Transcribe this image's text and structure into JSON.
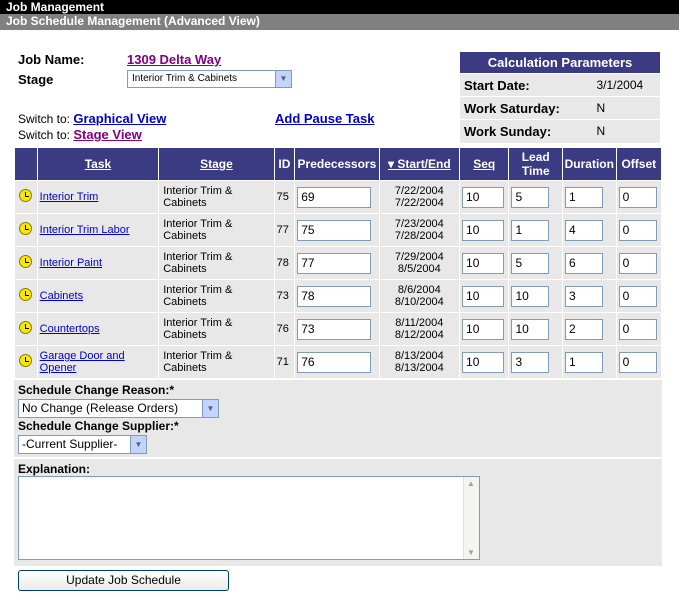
{
  "header": {
    "title": "Job Management",
    "subtitle": "Job Schedule Management (Advanced View)"
  },
  "job": {
    "name_label": "Job Name:",
    "name": "1309 Delta Way",
    "stage_label": "Stage",
    "stage_value": "Interior Trim & Cabinets"
  },
  "switch": {
    "prefix1": "Switch to:",
    "graphical": "Graphical View",
    "prefix2": "Switch to:",
    "stage": "Stage View",
    "add_pause": "Add Pause Task"
  },
  "calc": {
    "title": "Calculation Parameters",
    "rows": [
      {
        "label": "Start Date:",
        "value": "3/1/2004"
      },
      {
        "label": "Work Saturday:",
        "value": "N"
      },
      {
        "label": "Work Sunday:",
        "value": "N"
      }
    ]
  },
  "table": {
    "headers": {
      "task": "Task",
      "stage": "Stage",
      "id": "ID",
      "predecessors": "Predecessors",
      "startend": "Start/End",
      "seq": "Seq",
      "lead1": "Lead",
      "lead2": "Time",
      "duration": "Duration",
      "offset": "Offset"
    },
    "rows": [
      {
        "task": "Interior Trim",
        "stage1": "Interior Trim &",
        "stage2": "Cabinets",
        "id": "75",
        "pred": "69",
        "start": "7/22/2004",
        "end": "7/22/2004",
        "seq": "10",
        "lead": "5",
        "duration": "1",
        "offset": "0"
      },
      {
        "task": "Interior Trim Labor",
        "stage1": "Interior Trim &",
        "stage2": "Cabinets",
        "id": "77",
        "pred": "75",
        "start": "7/23/2004",
        "end": "7/28/2004",
        "seq": "10",
        "lead": "1",
        "duration": "4",
        "offset": "0"
      },
      {
        "task": "Interior Paint",
        "stage1": "Interior Trim &",
        "stage2": "Cabinets",
        "id": "78",
        "pred": "77",
        "start": "7/29/2004",
        "end": "8/5/2004",
        "seq": "10",
        "lead": "5",
        "duration": "6",
        "offset": "0"
      },
      {
        "task": "Cabinets",
        "stage1": "Interior Trim &",
        "stage2": "Cabinets",
        "id": "73",
        "pred": "78",
        "start": "8/6/2004",
        "end": "8/10/2004",
        "seq": "10",
        "lead": "10",
        "duration": "3",
        "offset": "0"
      },
      {
        "task": "Countertops",
        "stage1": "Interior Trim &",
        "stage2": "Cabinets",
        "id": "76",
        "pred": "73",
        "start": "8/11/2004",
        "end": "8/12/2004",
        "seq": "10",
        "lead": "10",
        "duration": "2",
        "offset": "0"
      },
      {
        "task1": "Garage Door and",
        "task2": "Opener",
        "stage1": "Interior Trim &",
        "stage2": "Cabinets",
        "id": "71",
        "pred": "76",
        "start": "8/13/2004",
        "end": "8/13/2004",
        "seq": "10",
        "lead": "3",
        "duration": "1",
        "offset": "0"
      }
    ]
  },
  "form": {
    "reason_label": "Schedule Change Reason:*",
    "reason_value": "No Change (Release Orders)",
    "supplier_label": "Schedule Change Supplier:*",
    "supplier_value": "-Current Supplier-",
    "explanation_label": "Explanation:",
    "submit": "Update Job Schedule"
  }
}
